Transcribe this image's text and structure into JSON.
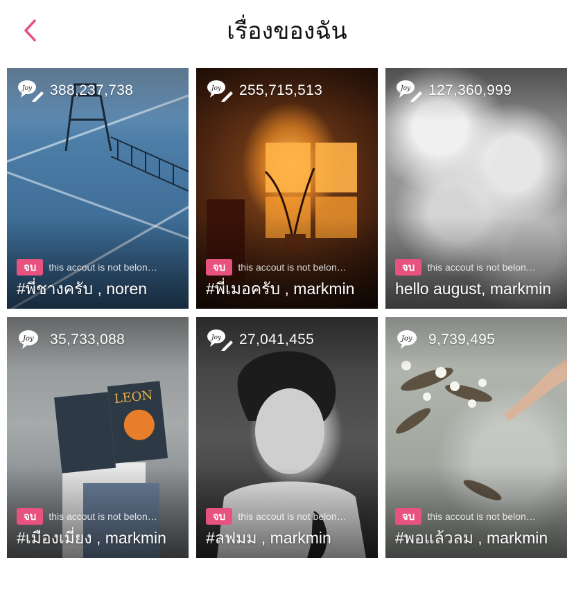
{
  "header": {
    "title": "เรื่องของฉัน",
    "back_icon": "chevron-left-icon",
    "accent_color": "#e8527f"
  },
  "stories": [
    {
      "views": "388,237,738",
      "badge": "จบ",
      "author_note": "this accout is not belon…",
      "title": "#พี่ชางครับ , noren",
      "icon": "joy-pen-icon"
    },
    {
      "views": "255,715,513",
      "badge": "จบ",
      "author_note": "this accout is not belon…",
      "title": "#พี่เมอครับ , markmin",
      "icon": "joy-pen-icon"
    },
    {
      "views": "127,360,999",
      "badge": "จบ",
      "author_note": "this accout is not belon…",
      "title": "hello august, markmin",
      "icon": "joy-pen-icon"
    },
    {
      "views": "35,733,088",
      "badge": "จบ",
      "author_note": "this accout is not belon…",
      "title": "#เมืองเมี่ยง , markmin",
      "icon": "joy-icon"
    },
    {
      "views": "27,041,455",
      "badge": "จบ",
      "author_note": "this accout is not belon…",
      "title": "#ลฟมม , markmin",
      "icon": "joy-pen-icon"
    },
    {
      "views": "9,739,495",
      "badge": "จบ",
      "author_note": "this accout is not belon…",
      "title": "#พอแล้วลม , markmin",
      "icon": "joy-icon"
    }
  ]
}
